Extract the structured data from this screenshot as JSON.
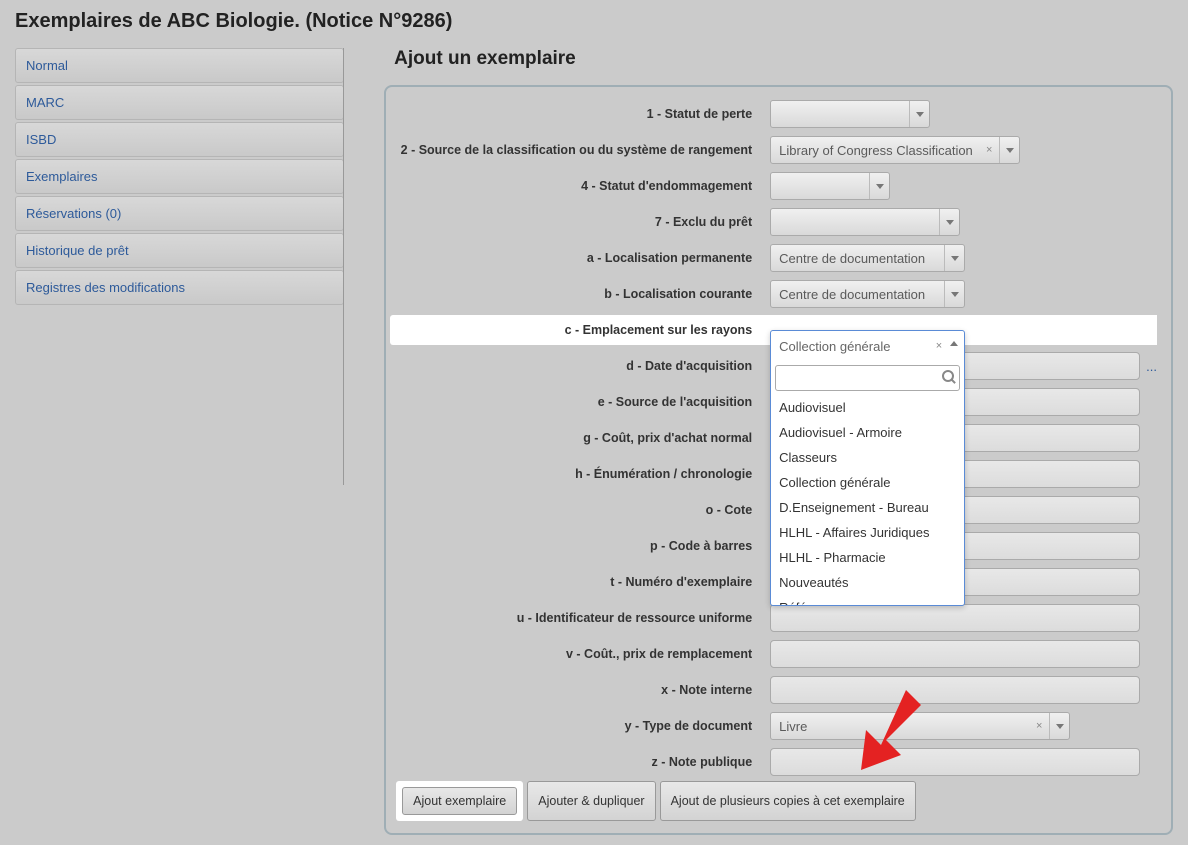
{
  "page_title": "Exemplaires de ABC Biologie. (Notice N°9286)",
  "main_title": "Ajout un exemplaire",
  "sidebar": {
    "items": [
      "Normal",
      "MARC",
      "ISBD",
      "Exemplaires",
      "Réservations (0)",
      "Historique de prêt",
      "Registres des modifications"
    ]
  },
  "form": {
    "fields": {
      "f1": {
        "label": "1 - Statut de perte",
        "value": ""
      },
      "f2": {
        "label": "2 - Source de la classification ou du système de rangement",
        "value": "Library of Congress Classification"
      },
      "f4": {
        "label": "4 - Statut d'endommagement",
        "value": ""
      },
      "f7": {
        "label": "7 - Exclu du prêt",
        "value": ""
      },
      "fa": {
        "label": "a - Localisation permanente",
        "value": "Centre de documentation"
      },
      "fb": {
        "label": "b - Localisation courante",
        "value": "Centre de documentation"
      },
      "fc": {
        "label": "c - Emplacement sur les rayons",
        "value": "Collection générale"
      },
      "fd": {
        "label": "d - Date d'acquisition"
      },
      "fe": {
        "label": "e - Source de l'acquisition"
      },
      "fg": {
        "label": "g - Coût, prix d'achat normal"
      },
      "fh": {
        "label": "h - Énumération / chronologie"
      },
      "fo": {
        "label": "o - Cote"
      },
      "fp": {
        "label": "p - Code à barres"
      },
      "ft": {
        "label": "t - Numéro d'exemplaire"
      },
      "fu": {
        "label": "u - Identificateur de ressource uniforme"
      },
      "fv": {
        "label": "v - Coût., prix de remplacement"
      },
      "fx": {
        "label": "x - Note interne"
      },
      "fy": {
        "label": "y - Type de document",
        "value": "Livre"
      },
      "fz": {
        "label": "z - Note publique"
      }
    },
    "dropdown_options": [
      "Audiovisuel",
      "Audiovisuel - Armoire",
      "Classeurs",
      "Collection générale",
      "D.Enseignement - Bureau",
      "HLHL - Affaires Juridiques",
      "HLHL - Pharmacie",
      "Nouveautés",
      "Référence"
    ]
  },
  "buttons": {
    "b1": "Ajout exemplaire",
    "b2": "Ajouter & dupliquer",
    "b3": "Ajout de plusieurs copies à cet exemplaire"
  },
  "ellipsis": "..."
}
